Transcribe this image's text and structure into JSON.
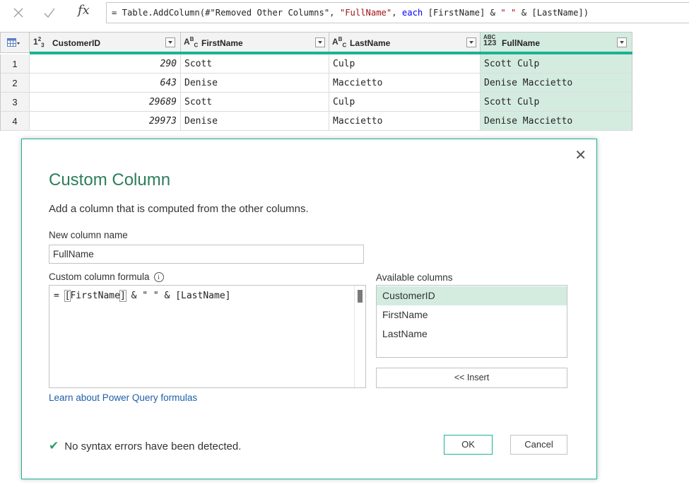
{
  "formula_bar": {
    "formula_parts": [
      {
        "text": "= Table.AddColumn(#\"Removed Other Columns\", ",
        "kind": "plain"
      },
      {
        "text": "\"FullName\"",
        "kind": "str"
      },
      {
        "text": ", ",
        "kind": "plain"
      },
      {
        "text": "each",
        "kind": "kw"
      },
      {
        "text": " [FirstName] & ",
        "kind": "plain"
      },
      {
        "text": "\" \"",
        "kind": "str"
      },
      {
        "text": " & [LastName])",
        "kind": "plain"
      }
    ]
  },
  "grid": {
    "columns": [
      {
        "type": "1²₃",
        "label": "CustomerID"
      },
      {
        "type": "A^B_C",
        "label": "FirstName"
      },
      {
        "type": "A^B_C",
        "label": "LastName"
      },
      {
        "type": "ABC 123",
        "label": "FullName"
      }
    ],
    "rows": [
      {
        "n": "1",
        "id": "290",
        "first": "Scott",
        "last": "Culp",
        "full": "Scott Culp"
      },
      {
        "n": "2",
        "id": "643",
        "first": "Denise",
        "last": "Maccietto",
        "full": "Denise Maccietto"
      },
      {
        "n": "3",
        "id": "29689",
        "first": "Scott",
        "last": "Culp",
        "full": "Scott Culp"
      },
      {
        "n": "4",
        "id": "29973",
        "first": "Denise",
        "last": "Maccietto",
        "full": "Denise Maccietto"
      }
    ]
  },
  "dialog": {
    "title": "Custom Column",
    "description": "Add a column that is computed from the other columns.",
    "new_column_label": "New column name",
    "new_column_value": "FullName",
    "formula_label": "Custom column formula",
    "formula_parts": [
      "= ",
      "[",
      "FirstName",
      "]",
      " & \" \" & [LastName]"
    ],
    "available_label": "Available columns",
    "available_columns": [
      "CustomerID",
      "FirstName",
      "LastName"
    ],
    "insert_label": "<< Insert",
    "learn_link": "Learn about Power Query formulas",
    "status": "No syntax errors have been detected.",
    "ok_label": "OK",
    "cancel_label": "Cancel",
    "close_glyph": "✕"
  },
  "colors": {
    "accent": "#1ab394",
    "selected_bg": "#d4ece0",
    "title_green": "#2e7d5b"
  }
}
